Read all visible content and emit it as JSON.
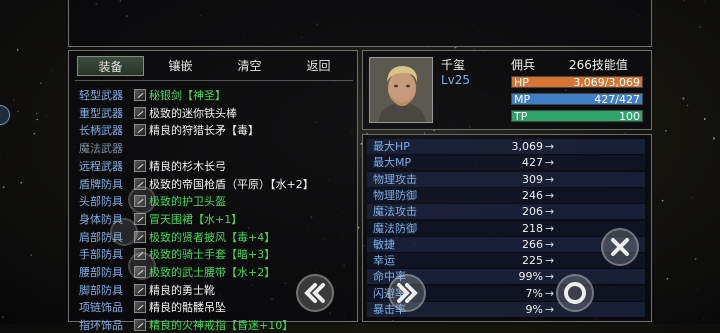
{
  "tabs": [
    {
      "label": "装备",
      "active": true
    },
    {
      "label": "镶嵌",
      "active": false
    },
    {
      "label": "清空",
      "active": false
    },
    {
      "label": "返回",
      "active": false
    }
  ],
  "equipment": [
    {
      "slot": "轻型武器",
      "item": "秘银剑【神圣】",
      "quality": "green",
      "icon": "sword-icon"
    },
    {
      "slot": "重型武器",
      "item": "极致的迷你铁头棒",
      "quality": "white",
      "icon": "club-icon"
    },
    {
      "slot": "长柄武器",
      "item": "精良的狩猎长矛【毒】",
      "quality": "white",
      "icon": "spear-icon"
    },
    {
      "slot": "魔法武器",
      "item": "",
      "quality": "empty",
      "icon": ""
    },
    {
      "slot": "远程武器",
      "item": "精良的杉木长弓",
      "quality": "white",
      "icon": "bow-icon"
    },
    {
      "slot": "盾牌防具",
      "item": "极致的帝国枪盾（平原）【水+2】",
      "quality": "white",
      "icon": "shield-icon"
    },
    {
      "slot": "头部防具",
      "item": "极致的护卫头盔",
      "quality": "green",
      "icon": "helmet-icon"
    },
    {
      "slot": "身体防具",
      "item": "冒天围裙【水+1】",
      "quality": "green",
      "icon": "armor-icon"
    },
    {
      "slot": "肩部防具",
      "item": "极致的贤者披风【毒+4】",
      "quality": "green",
      "icon": "cape-icon"
    },
    {
      "slot": "手部防具",
      "item": "极致的骑士手套【暗+3】",
      "quality": "green",
      "icon": "gloves-icon"
    },
    {
      "slot": "腰部防具",
      "item": "极致的武士腰带【水+2】",
      "quality": "green",
      "icon": "belt-icon"
    },
    {
      "slot": "脚部防具",
      "item": "精良的勇士靴",
      "quality": "white",
      "icon": "boots-icon"
    },
    {
      "slot": "项链饰品",
      "item": "精良的骷髅吊坠",
      "quality": "white",
      "icon": "necklace-icon"
    },
    {
      "slot": "指环饰品",
      "item": "精良的火神戒指【昏迷+10】",
      "quality": "green",
      "icon": "ring-icon"
    }
  ],
  "character": {
    "name": "千玺",
    "class": "佣兵",
    "skill_points": "266技能值",
    "level": "Lv25",
    "hp": {
      "label": "HP",
      "value": "3,069/3,069",
      "fraction": 1.0,
      "color": "#d8742f"
    },
    "mp": {
      "label": "MP",
      "value": "427/427",
      "fraction": 1.0,
      "color": "#3f7fc8"
    },
    "tp": {
      "label": "TP",
      "value": "100",
      "fraction": 1.0,
      "color": "#2fa56a"
    }
  },
  "stats": [
    {
      "name": "最大HP",
      "value": "3,069",
      "arrow": "→"
    },
    {
      "name": "最大MP",
      "value": "427",
      "arrow": "→"
    },
    {
      "name": "物理攻击",
      "value": "309",
      "arrow": "→"
    },
    {
      "name": "物理防御",
      "value": "246",
      "arrow": "→"
    },
    {
      "name": "魔法攻击",
      "value": "206",
      "arrow": "→"
    },
    {
      "name": "魔法防御",
      "value": "218",
      "arrow": "→"
    },
    {
      "name": "敏捷",
      "value": "266",
      "arrow": "→"
    },
    {
      "name": "幸运",
      "value": "225",
      "arrow": "→"
    },
    {
      "name": "命中率",
      "value": "99%",
      "arrow": "→"
    },
    {
      "name": "闪避率",
      "value": "7%",
      "arrow": "→"
    },
    {
      "name": "暴击率",
      "value": "9%",
      "arrow": "→"
    }
  ],
  "controls": {
    "close_icon": "close-icon",
    "back_icon": "double-chevron-left-icon",
    "forward_icon": "double-chevron-right-icon",
    "confirm_icon": "circle-icon"
  }
}
